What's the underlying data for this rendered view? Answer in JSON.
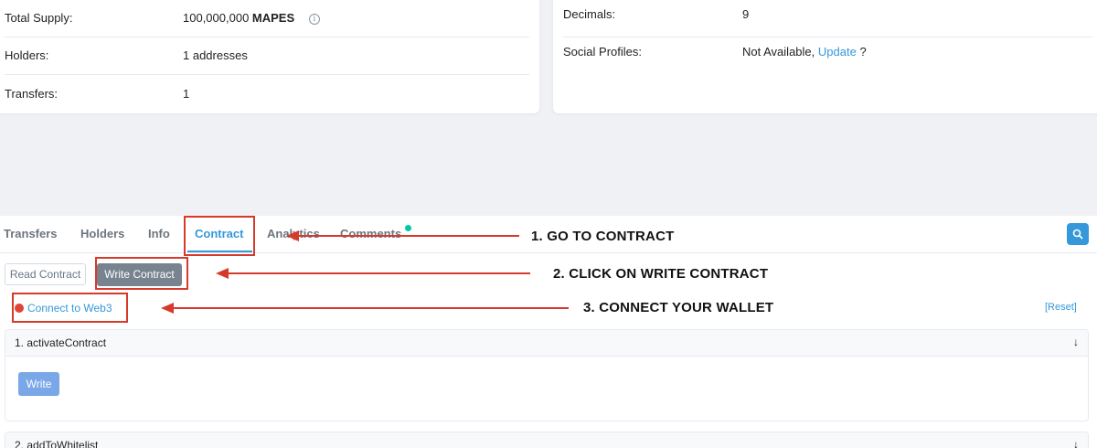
{
  "token_info_left": {
    "rows": [
      {
        "label": "Total Supply:",
        "value": "100,000,000",
        "unit": "MAPES"
      },
      {
        "label": "Holders:",
        "value": "1 addresses"
      },
      {
        "label": "Transfers:",
        "value": "1"
      }
    ]
  },
  "token_info_right": {
    "decimals_label": "Decimals:",
    "decimals_value": "9",
    "social_label": "Social Profiles:",
    "social_value": "Not Available,",
    "social_update_link": "Update",
    "social_suffix": "?"
  },
  "tabs": [
    {
      "label": "Transfers"
    },
    {
      "label": "Holders"
    },
    {
      "label": "Info"
    },
    {
      "label": "Contract",
      "active": true
    },
    {
      "label": "Analytics"
    },
    {
      "label": "Comments"
    }
  ],
  "contract": {
    "read_button": "Read Contract",
    "write_button": "Write Contract",
    "connect_link": "Connect to Web3",
    "reset_link": "[Reset]",
    "functions": [
      {
        "name": "1. activateContract",
        "button": "Write"
      },
      {
        "name": "2. addToWhitelist"
      }
    ]
  },
  "annotations": {
    "step1": "1. GO TO CONTRACT",
    "step2": "2. CLICK ON WRITE CONTRACT",
    "step3": "3. CONNECT YOUR WALLET"
  },
  "colors": {
    "accent": "#3498db",
    "annotation_red": "#d63a2b",
    "status_dot_green": "#00c9a7",
    "disconnected_red": "#de4437"
  },
  "icons": {
    "search": "search-icon",
    "info": "info-circle-icon",
    "expand": "arrow-down-icon"
  }
}
